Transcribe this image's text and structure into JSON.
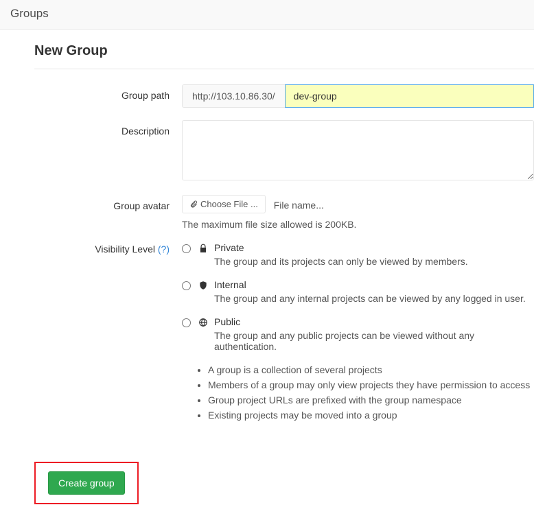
{
  "header": {
    "title": "Groups"
  },
  "page": {
    "title": "New Group"
  },
  "form": {
    "group_path": {
      "label": "Group path",
      "prefix": "http://103.10.86.30/",
      "value": "dev-group"
    },
    "description": {
      "label": "Description",
      "value": ""
    },
    "avatar": {
      "label": "Group avatar",
      "button": "Choose File ...",
      "filename": "File name...",
      "hint": "The maximum file size allowed is 200KB."
    },
    "visibility": {
      "label": "Visibility Level",
      "help": "(?)",
      "options": [
        {
          "id": "private",
          "title": "Private",
          "desc": "The group and its projects can only be viewed by members."
        },
        {
          "id": "internal",
          "title": "Internal",
          "desc": "The group and any internal projects can be viewed by any logged in user."
        },
        {
          "id": "public",
          "title": "Public",
          "desc": "The group and any public projects can be viewed without any authentication."
        }
      ]
    },
    "info": [
      "A group is a collection of several projects",
      "Members of a group may only view projects they have permission to access",
      "Group project URLs are prefixed with the group namespace",
      "Existing projects may be moved into a group"
    ],
    "submit": "Create group"
  }
}
